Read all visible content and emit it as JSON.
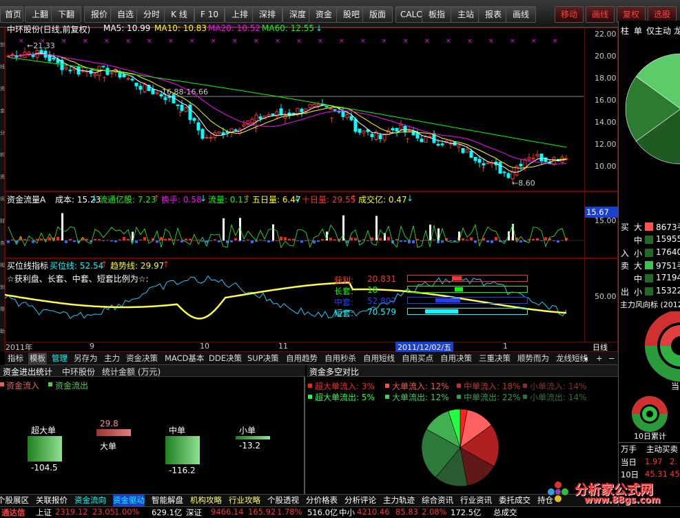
{
  "toolbar": {
    "buttons": [
      "首页",
      "上翻",
      "下翻",
      "报价",
      "自选",
      "分时",
      "K 线",
      "F 10",
      "上排",
      "深排",
      "深度",
      "资金",
      "股吧",
      "版面",
      "CALC",
      "板指",
      "主站",
      "报表",
      "画线"
    ],
    "right_buttons": [
      "移动",
      "画线",
      "复权",
      "选股"
    ]
  },
  "colors": {
    "up": "#ff3030",
    "down": "#00ffff",
    "ma5": "#ffffff",
    "ma10": "#ffff00",
    "ma20": "#ff00ff",
    "ma60": "#00ff00",
    "panel_border": "#800000",
    "accent_blue": "#1b3fd1"
  },
  "kline": {
    "items": [
      {
        "label": "中环股份(日线,前复权)",
        "color": "#ffffff"
      },
      {
        "label": "MA5: 10.99",
        "color": "#ffffff"
      },
      {
        "label": "MA10: 10.83",
        "color": "#ffff00"
      },
      {
        "label": "MA20: 10.52",
        "color": "#ff00ff"
      },
      {
        "label": "MA60: 12.55",
        "color": "#00ff00"
      }
    ],
    "high_label": "21.33",
    "range_label": "16.88-16.66",
    "low_label": "8.60",
    "y_ticks": [
      "22.00",
      "20.00",
      "18.00",
      "16.00",
      "14.00",
      "12.00",
      "10.00"
    ],
    "x_ticks": [
      "2011年",
      "9",
      "10",
      "11",
      "1"
    ],
    "cursor_date": "2011/12/02/五",
    "period": "日线"
  },
  "fund": {
    "title": "资金流量A",
    "items": [
      {
        "label": "成本: 15.23",
        "color": "#ffffff"
      },
      {
        "label": "流通亿股: 7.23",
        "color": "#00ff00"
      },
      {
        "label": "换手: 0.58",
        "color": "#ff00ff"
      },
      {
        "label": "流量: 0.13",
        "color": "#00ff00"
      },
      {
        "label": "五日量: 6.47",
        "color": "#ffff00"
      },
      {
        "label": "十日量: 29.55",
        "color": "#ff3030"
      },
      {
        "label": "成交亿: 0.47",
        "color": "#ffff00"
      }
    ],
    "y_label": "15.67",
    "y_tick": "15.00"
  },
  "buy": {
    "title": "买位线指标",
    "items": [
      {
        "label": "买位线: 52.54",
        "color": "#00ffff"
      },
      {
        "label": "趋势线: 29.97",
        "color": "#ffff00"
      }
    ],
    "subtitle": "☆获利盘、长套、中套、短套比例为☆:",
    "y_tick": "50.00",
    "stats": [
      {
        "label": "获利:",
        "value": "20.831",
        "color": "#ff3030",
        "fill": 0.21
      },
      {
        "label": "长套:",
        "value": "18",
        "color": "#00ff00",
        "fill": 0.18
      },
      {
        "label": "中套:",
        "value": "52.807",
        "color": "#2040ff",
        "fill": 0.53
      },
      {
        "label": "短套:",
        "value": "70.579",
        "color": "#00ffff",
        "fill": 0.71
      }
    ]
  },
  "tabs": [
    "指标",
    "模板",
    "管理",
    "另存为",
    "主力",
    "资金决策",
    "MACD基本",
    "DDE决策",
    "SUP决策",
    "自用趋势",
    "自用秒杀",
    "自用短线",
    "自用买点",
    "自用决策",
    "三重决策",
    "顺势而为",
    "龙线短线"
  ],
  "left_panel": {
    "title": "资金进出统计",
    "stock": "中环股份",
    "unit": "统计金额 (万元)",
    "legend_in": "资金流入",
    "legend_out": "资金流出",
    "bars": [
      {
        "label": "超大单",
        "value": -104.5
      },
      {
        "label": "大单",
        "value": 29.8
      },
      {
        "label": "中单",
        "value": -116.2
      },
      {
        "label": "小单",
        "value": -13.2
      }
    ]
  },
  "right_panel": {
    "title": "资金多空对比",
    "legend": [
      [
        "超大单流入: 3%",
        "大单流入: 12%",
        "中单流入: 18%",
        "小单流入: 14%"
      ],
      [
        "超大单流出: 5%",
        "大单流出: 12%",
        "中单流出: 22%",
        "小单流出: 14%"
      ]
    ],
    "legend_colors": [
      [
        "#ff2020",
        "#ff5050",
        "#c03030",
        "#803030"
      ],
      [
        "#20ff40",
        "#40d060",
        "#30a050",
        "#307040"
      ]
    ],
    "slices": [
      {
        "v": 3,
        "c": "#ff2020"
      },
      {
        "v": 12,
        "c": "#ff6060"
      },
      {
        "v": 18,
        "c": "#b02020"
      },
      {
        "v": 14,
        "c": "#601818"
      },
      {
        "v": 14,
        "c": "#2a5a30"
      },
      {
        "v": 22,
        "c": "#2e7a3a"
      },
      {
        "v": 12,
        "c": "#40b050"
      },
      {
        "v": 5,
        "c": "#20ff40"
      }
    ]
  },
  "bottom_tabs": [
    "个股展区",
    "关联报价",
    "资金流向",
    "资金驱动",
    "智能解盘",
    "机构攻略",
    "行业攻略",
    "个股透视",
    "分价格表",
    "分析评论",
    "主力轨迹",
    "综合资讯",
    "行业资讯",
    "委托成交",
    "持仓"
  ],
  "status": {
    "brand": "通达信",
    "items": [
      {
        "t": "上证",
        "c": "#ffffff"
      },
      {
        "t": "2319.12",
        "c": "#ff3030"
      },
      {
        "t": "23.05",
        "c": "#ff3030"
      },
      {
        "t": "1.00%",
        "c": "#ff3030"
      },
      {
        "t": "629.1亿",
        "c": "#ffffff"
      },
      {
        "t": "深证",
        "c": "#ffffff"
      },
      {
        "t": "9466.14",
        "c": "#ff3030"
      },
      {
        "t": "165.92",
        "c": "#ff3030"
      },
      {
        "t": "1.78%",
        "c": "#ff3030"
      },
      {
        "t": "516.0亿",
        "c": "#ffffff"
      },
      {
        "t": "中小",
        "c": "#ffffff"
      },
      {
        "t": "4210.46",
        "c": "#ff3030"
      },
      {
        "t": "85.83",
        "c": "#ff3030"
      },
      {
        "t": "2.08%",
        "c": "#ff3030"
      },
      {
        "t": "172.5亿",
        "c": "#ffffff"
      },
      {
        "t": "总成交",
        "c": "#ffffff"
      }
    ]
  },
  "sidebar_left": [
    "划",
    "线",
    "资",
    "金",
    "分",
    "析",
    "资",
    "讯",
    "财",
    "务",
    "规",
    "划",
    "帮",
    "助"
  ],
  "right_side": {
    "tabs": [
      "柱",
      "单",
      "仅主动",
      "龙虎"
    ],
    "buy_label": "买",
    "sell_label": "卖",
    "in_label": "入",
    "out_label": "出",
    "rows_buy": [
      [
        "大",
        "8673手"
      ],
      [
        "中",
        "15955"
      ],
      [
        "小",
        "17640"
      ]
    ],
    "rows_sell": [
      [
        "大",
        "9751手"
      ],
      [
        "中",
        "17194"
      ],
      [
        "小",
        "15322"
      ]
    ],
    "wind_title": "主力风向标 (2012",
    "current": "当",
    "accum": "10日累计",
    "table_head": [
      "万手",
      "主动买卖"
    ],
    "table_rows": [
      [
        "当日",
        "1.97",
        "2."
      ],
      [
        "10日",
        "45.31",
        "45."
      ]
    ],
    "pie1": [
      {
        "v": 35,
        "c": "#3ba64a"
      },
      {
        "v": 30,
        "c": "#1f5a23"
      },
      {
        "v": 20,
        "c": "#2b7c30"
      },
      {
        "v": 15,
        "c": "#5ccb6a"
      }
    ]
  },
  "watermark": {
    "main": "分析家公式网",
    "url": "www.88gs.com"
  }
}
